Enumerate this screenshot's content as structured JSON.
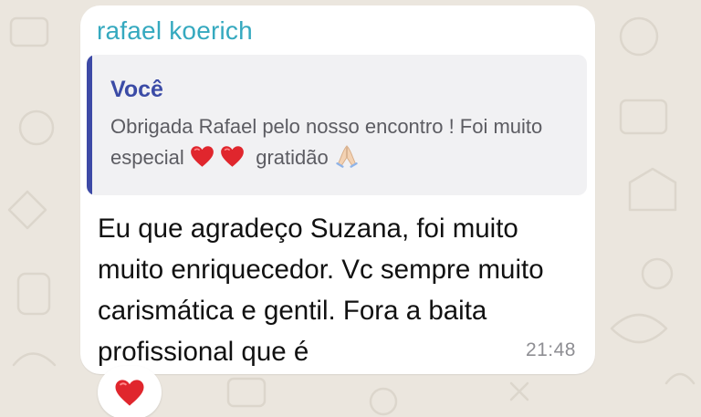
{
  "message": {
    "sender_name": "rafael koerich",
    "quoted": {
      "author": "Você",
      "text_part1": "Obrigada Rafael pelo nosso encontro ! Foi muito especial",
      "text_part2": "gratidão",
      "emojis": [
        "red-heart-emoji",
        "red-heart-emoji",
        "folded-hands-emoji"
      ]
    },
    "body": "Eu que agradeço Suzana, foi muito muito enriquecedor. Vc sempre muito carismática e gentil. Fora a baita profissional que é",
    "time": "21:48",
    "reaction": "red-heart-emoji"
  },
  "colors": {
    "sender": "#35a9bf",
    "quote_bar": "#3d4aa6",
    "quote_author": "#3b4ba6",
    "heart": "#e0262d",
    "wallpaper": "#ebe6de"
  }
}
